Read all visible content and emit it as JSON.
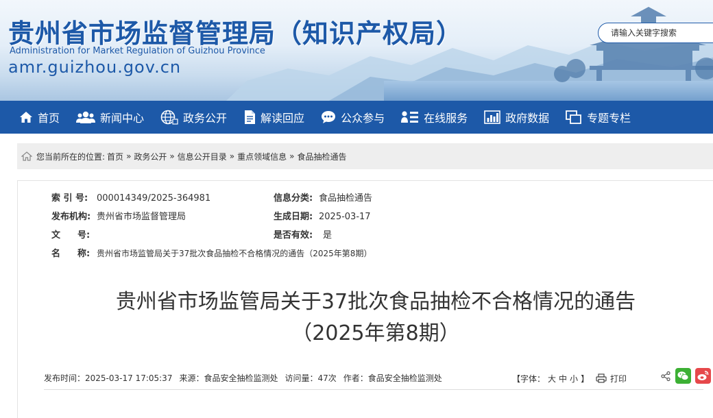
{
  "header": {
    "site_title": "贵州省市场监督管理局（知识产权局）",
    "site_subtitle": "Administration for Market Regulation of Guizhou Province",
    "site_domain": "amr.guizhou.gov.cn",
    "search_placeholder": "请输入关键字搜索"
  },
  "nav": {
    "items": [
      {
        "label": "首页",
        "icon": "home-icon"
      },
      {
        "label": "新闻中心",
        "icon": "people-icon"
      },
      {
        "label": "政务公开",
        "icon": "globe-icon"
      },
      {
        "label": "解读回应",
        "icon": "document-icon"
      },
      {
        "label": "公众参与",
        "icon": "chat-icon"
      },
      {
        "label": "在线服务",
        "icon": "user-list-icon"
      },
      {
        "label": "政府数据",
        "icon": "bar-chart-icon"
      },
      {
        "label": "专题专栏",
        "icon": "window-icon"
      }
    ]
  },
  "breadcrumb": {
    "prefix": "您当前所在的位置:",
    "items": [
      "首页",
      "政务公开",
      "信息公开目录",
      "重点领域信息",
      "食品抽检通告"
    ],
    "separator": "»"
  },
  "meta": {
    "index_label": "索 引 号:",
    "index_value": "000014349/2025-364981",
    "category_label": "信息分类:",
    "category_value": "食品抽检通告",
    "publisher_label": "发布机构:",
    "publisher_value": "贵州省市场监督管理局",
    "date_label": "生成日期:",
    "date_value": "2025-03-17",
    "docno_label_a": "文",
    "docno_label_b": "号:",
    "docno_value": "",
    "valid_label": "是否有效:",
    "valid_value": "是",
    "name_label_a": "名",
    "name_label_b": "称:",
    "name_value": "贵州省市场监管局关于37批次食品抽检不合格情况的通告（2025年第8期）"
  },
  "article": {
    "title_line1": "贵州省市场监管局关于37批次食品抽检不合格情况的通告",
    "title_line2": "（2025年第8期）",
    "publish_time": "发布时间：2025-03-17 17:05:37",
    "source": "来源：食品安全抽检监测处",
    "views": "访问量：47次",
    "author": "作者：食品安全抽检监测处",
    "font_label": "【字体：",
    "font_large": "大",
    "font_medium": "中",
    "font_small": "小",
    "font_close": "】",
    "print_label": "打印"
  },
  "colors": {
    "brand": "#1d59a8",
    "wechat": "#3cb034",
    "weibo": "#e6484b"
  }
}
